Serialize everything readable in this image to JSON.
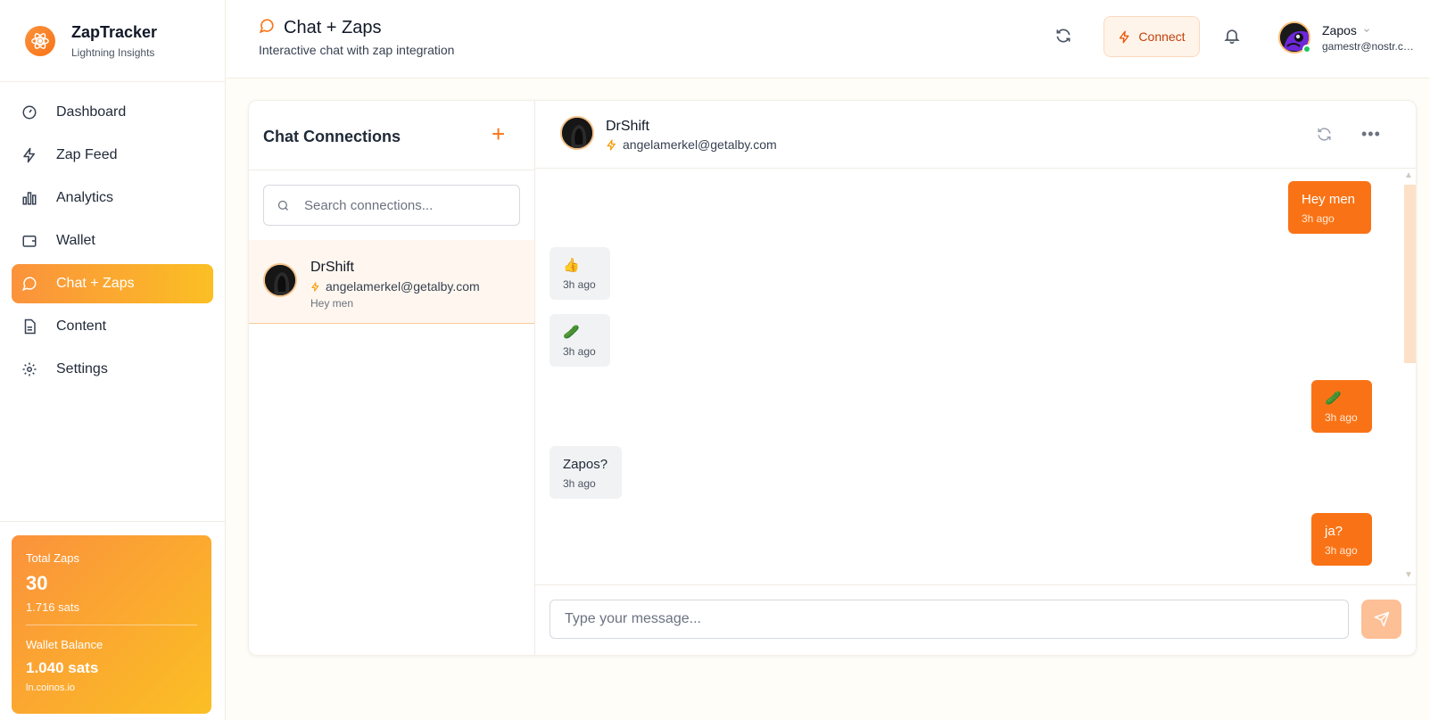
{
  "brand": {
    "title": "ZapTracker",
    "subtitle": "Lightning Insights"
  },
  "nav": [
    {
      "label": "Dashboard",
      "icon": "gauge-icon"
    },
    {
      "label": "Zap Feed",
      "icon": "lightning-icon"
    },
    {
      "label": "Analytics",
      "icon": "bar-chart-icon"
    },
    {
      "label": "Wallet",
      "icon": "wallet-icon"
    },
    {
      "label": "Chat + Zaps",
      "icon": "chat-bubble-icon",
      "active": true
    },
    {
      "label": "Content",
      "icon": "document-icon"
    },
    {
      "label": "Settings",
      "icon": "gear-icon"
    }
  ],
  "stats": {
    "total_zaps_label": "Total Zaps",
    "total_zaps": "30",
    "total_sats": "1.716 sats",
    "wallet_label": "Wallet Balance",
    "wallet_balance": "1.040 sats",
    "wallet_host": "ln.coinos.io"
  },
  "header": {
    "title": "Chat + Zaps",
    "subtitle": "Interactive chat with zap integration",
    "connect_label": "Connect",
    "user_name": "Zapos",
    "user_email": "gamestr@nostr.com"
  },
  "connections": {
    "title": "Chat Connections",
    "add_symbol": "+",
    "search_placeholder": "Search connections...",
    "items": [
      {
        "name": "DrShift",
        "address": "angelamerkel@getalby.com",
        "preview": "Hey men"
      }
    ]
  },
  "chat": {
    "name": "DrShift",
    "address": "angelamerkel@getalby.com",
    "more_symbol": "•••",
    "messages": [
      {
        "direction": "out",
        "text": "Hey men",
        "time": "3h ago"
      },
      {
        "direction": "in",
        "text": "👍",
        "time": "3h ago"
      },
      {
        "direction": "in",
        "text": "🥒",
        "time": "3h ago"
      },
      {
        "direction": "out",
        "text": "🥒",
        "time": "3h ago"
      },
      {
        "direction": "in",
        "text": "Zapos?",
        "time": "3h ago"
      },
      {
        "direction": "out",
        "text": "ja?",
        "time": "3h ago"
      }
    ],
    "composer_placeholder": "Type your message..."
  },
  "colors": {
    "accent": "#f97316",
    "accent_light": "#fbbf24",
    "online": "#22c55e"
  }
}
